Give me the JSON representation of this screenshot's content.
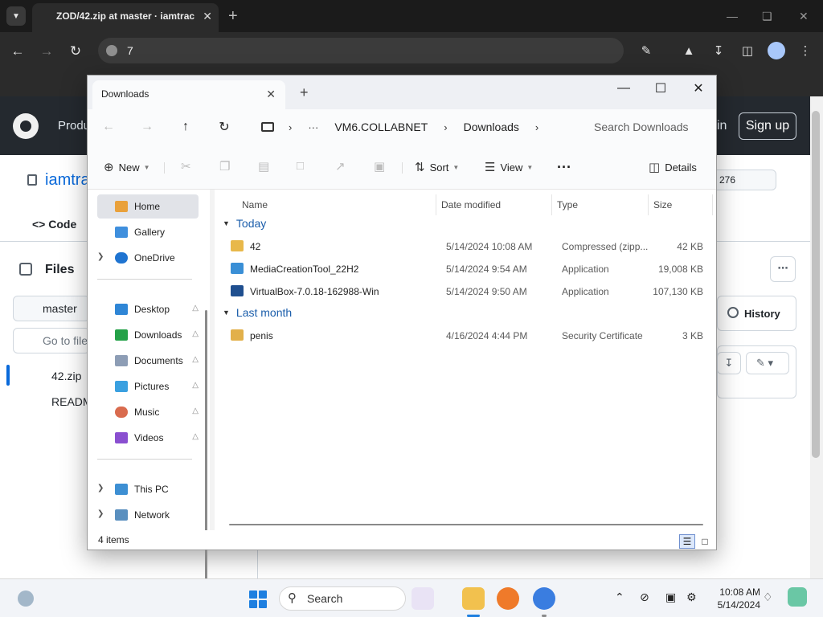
{
  "browser": {
    "tab_title": "ZOD/42.zip at master · iamtrac",
    "address": "7"
  },
  "github": {
    "product_label": "Produ",
    "sign_in_fragment": "in",
    "sign_up_label": "Sign up",
    "repo_name": "iamtra",
    "code_tab": "Code",
    "star_count": "276",
    "files_label": "Files",
    "branch": "master",
    "goto_placeholder": "Go to file",
    "files": [
      "42.zip",
      "READM"
    ],
    "history_label": "History"
  },
  "explorer": {
    "tab_title": "Downloads",
    "breadcrumbs": [
      "VM6.COLLABNET",
      "Downloads"
    ],
    "search_placeholder": "Search Downloads",
    "commands": {
      "new": "New",
      "sort": "Sort",
      "view": "View",
      "details": "Details"
    },
    "nav": {
      "home": "Home",
      "gallery": "Gallery",
      "onedrive": "OneDrive",
      "desktop": "Desktop",
      "downloads": "Downloads",
      "documents": "Documents",
      "pictures": "Pictures",
      "music": "Music",
      "videos": "Videos",
      "this_pc": "This PC",
      "network": "Network"
    },
    "columns": {
      "name": "Name",
      "date": "Date modified",
      "type": "Type",
      "size": "Size"
    },
    "groups": {
      "today": "Today",
      "last_month": "Last month"
    },
    "files": [
      {
        "name": "42",
        "date": "5/14/2024 10:08 AM",
        "type": "Compressed (zipp...",
        "size": "42 KB",
        "icon": "zip-folder-icon",
        "color": "#e8b84a"
      },
      {
        "name": "MediaCreationTool_22H2",
        "date": "5/14/2024 9:54 AM",
        "type": "Application",
        "size": "19,008 KB",
        "icon": "media-creation-tool-icon",
        "color": "#3a8fd6"
      },
      {
        "name": "VirtualBox-7.0.18-162988-Win",
        "date": "5/14/2024 9:50 AM",
        "type": "Application",
        "size": "107,130 KB",
        "icon": "virtualbox-icon",
        "color": "#1f4f8f"
      },
      {
        "name": "penis",
        "date": "4/16/2024 4:44 PM",
        "type": "Security Certificate",
        "size": "3 KB",
        "icon": "certificate-icon",
        "color": "#e2b04a"
      }
    ],
    "status": "4 items"
  },
  "taskbar": {
    "search_label": "Search",
    "time": "10:08 AM",
    "date": "5/14/2024"
  }
}
